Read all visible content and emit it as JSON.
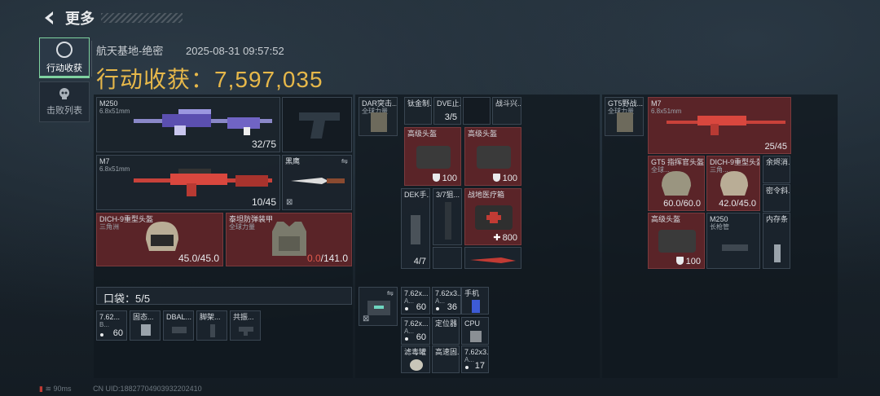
{
  "header": {
    "title": "更多",
    "back_icon": "back-arrow-icon"
  },
  "sidebar": {
    "tabs": [
      {
        "label": "行动收获",
        "icon": "target-icon",
        "active": true
      },
      {
        "label": "击败列表",
        "icon": "skull-icon",
        "active": false
      }
    ]
  },
  "raid": {
    "map": "航天基地-绝密",
    "datetime": "2025-08-31 09:57:52",
    "haul_label": "行动收获：",
    "haul_value": "7,597,035"
  },
  "loadout": {
    "primary": {
      "name": "M250",
      "sub": "6.8x51mm",
      "ammo": "32/75"
    },
    "pistol": {
      "name": ""
    },
    "secondary": {
      "name": "M7",
      "sub": "6.8x51mm",
      "ammo": "10/45"
    },
    "melee": {
      "name": "黑鹰"
    },
    "helmet": {
      "name": "DICH-9重型头盔",
      "sub": "三角洲",
      "durability": "45.0/45.0"
    },
    "armor": {
      "name": "泰坦防弹装甲",
      "sub": "全球力量",
      "durability_current": "0.0",
      "durability_max": "/141.0"
    }
  },
  "pocket": {
    "label": "口袋：5/5",
    "items": [
      {
        "name": "7.62...",
        "sub": "B...",
        "count": "60"
      },
      {
        "name": "固态..."
      },
      {
        "name": "DBAL..."
      },
      {
        "name": "脚架..."
      },
      {
        "name": "共振..."
      }
    ]
  },
  "chest_rig": {
    "name": "DAR突击...",
    "sub": "全球力量",
    "items": [
      {
        "name": "钛金制..."
      },
      {
        "name": "DVE止...",
        "count": "3/5"
      },
      {
        "name": ""
      },
      {
        "name": "战斗兴..."
      },
      {
        "name": "高级头盔",
        "count": "100"
      },
      {
        "name": "高级头盔",
        "count": "100"
      },
      {
        "name": "DEK手...",
        "count": "4/7"
      },
      {
        "name": "3/7狙..."
      },
      {
        "name": "战地医疗箱",
        "count": "800"
      },
      {
        "name": ""
      },
      {
        "name": ""
      }
    ]
  },
  "backpack": {
    "items": [
      {
        "name": "7.62x...",
        "sub": "A...",
        "count": "60"
      },
      {
        "name": "7.62x3...",
        "sub": "A...",
        "count": "36"
      },
      {
        "name": "手机"
      },
      {
        "name": "7.62x...",
        "sub": "A...",
        "count": "60"
      },
      {
        "name": "定位器"
      },
      {
        "name": "CPU"
      },
      {
        "name": "滤毒罐"
      },
      {
        "name": "高速固..."
      },
      {
        "name": "7.62x3...",
        "sub": "A...",
        "count": "17"
      }
    ]
  },
  "safe_box": {
    "name": "GT5野战...",
    "sub": "全球力量"
  },
  "stash": {
    "items": [
      {
        "name": "M7",
        "sub": "6.8x51mm",
        "count": "25/45"
      },
      {
        "name": "GT5 指挥官头盔",
        "sub": "全球...",
        "count": "60.0/60.0"
      },
      {
        "name": "DICH-9重型头盔",
        "sub": "三角...",
        "count": "42.0/45.0"
      },
      {
        "name": "余烬消..."
      },
      {
        "name": "密令斜..."
      },
      {
        "name": "高级头盔",
        "count": "100"
      },
      {
        "name": "M250",
        "sub": "长枪管"
      },
      {
        "name": "内存条"
      }
    ]
  },
  "status_bar": {
    "ping": "90ms",
    "uid": "CN UID:18827704903932202410"
  }
}
